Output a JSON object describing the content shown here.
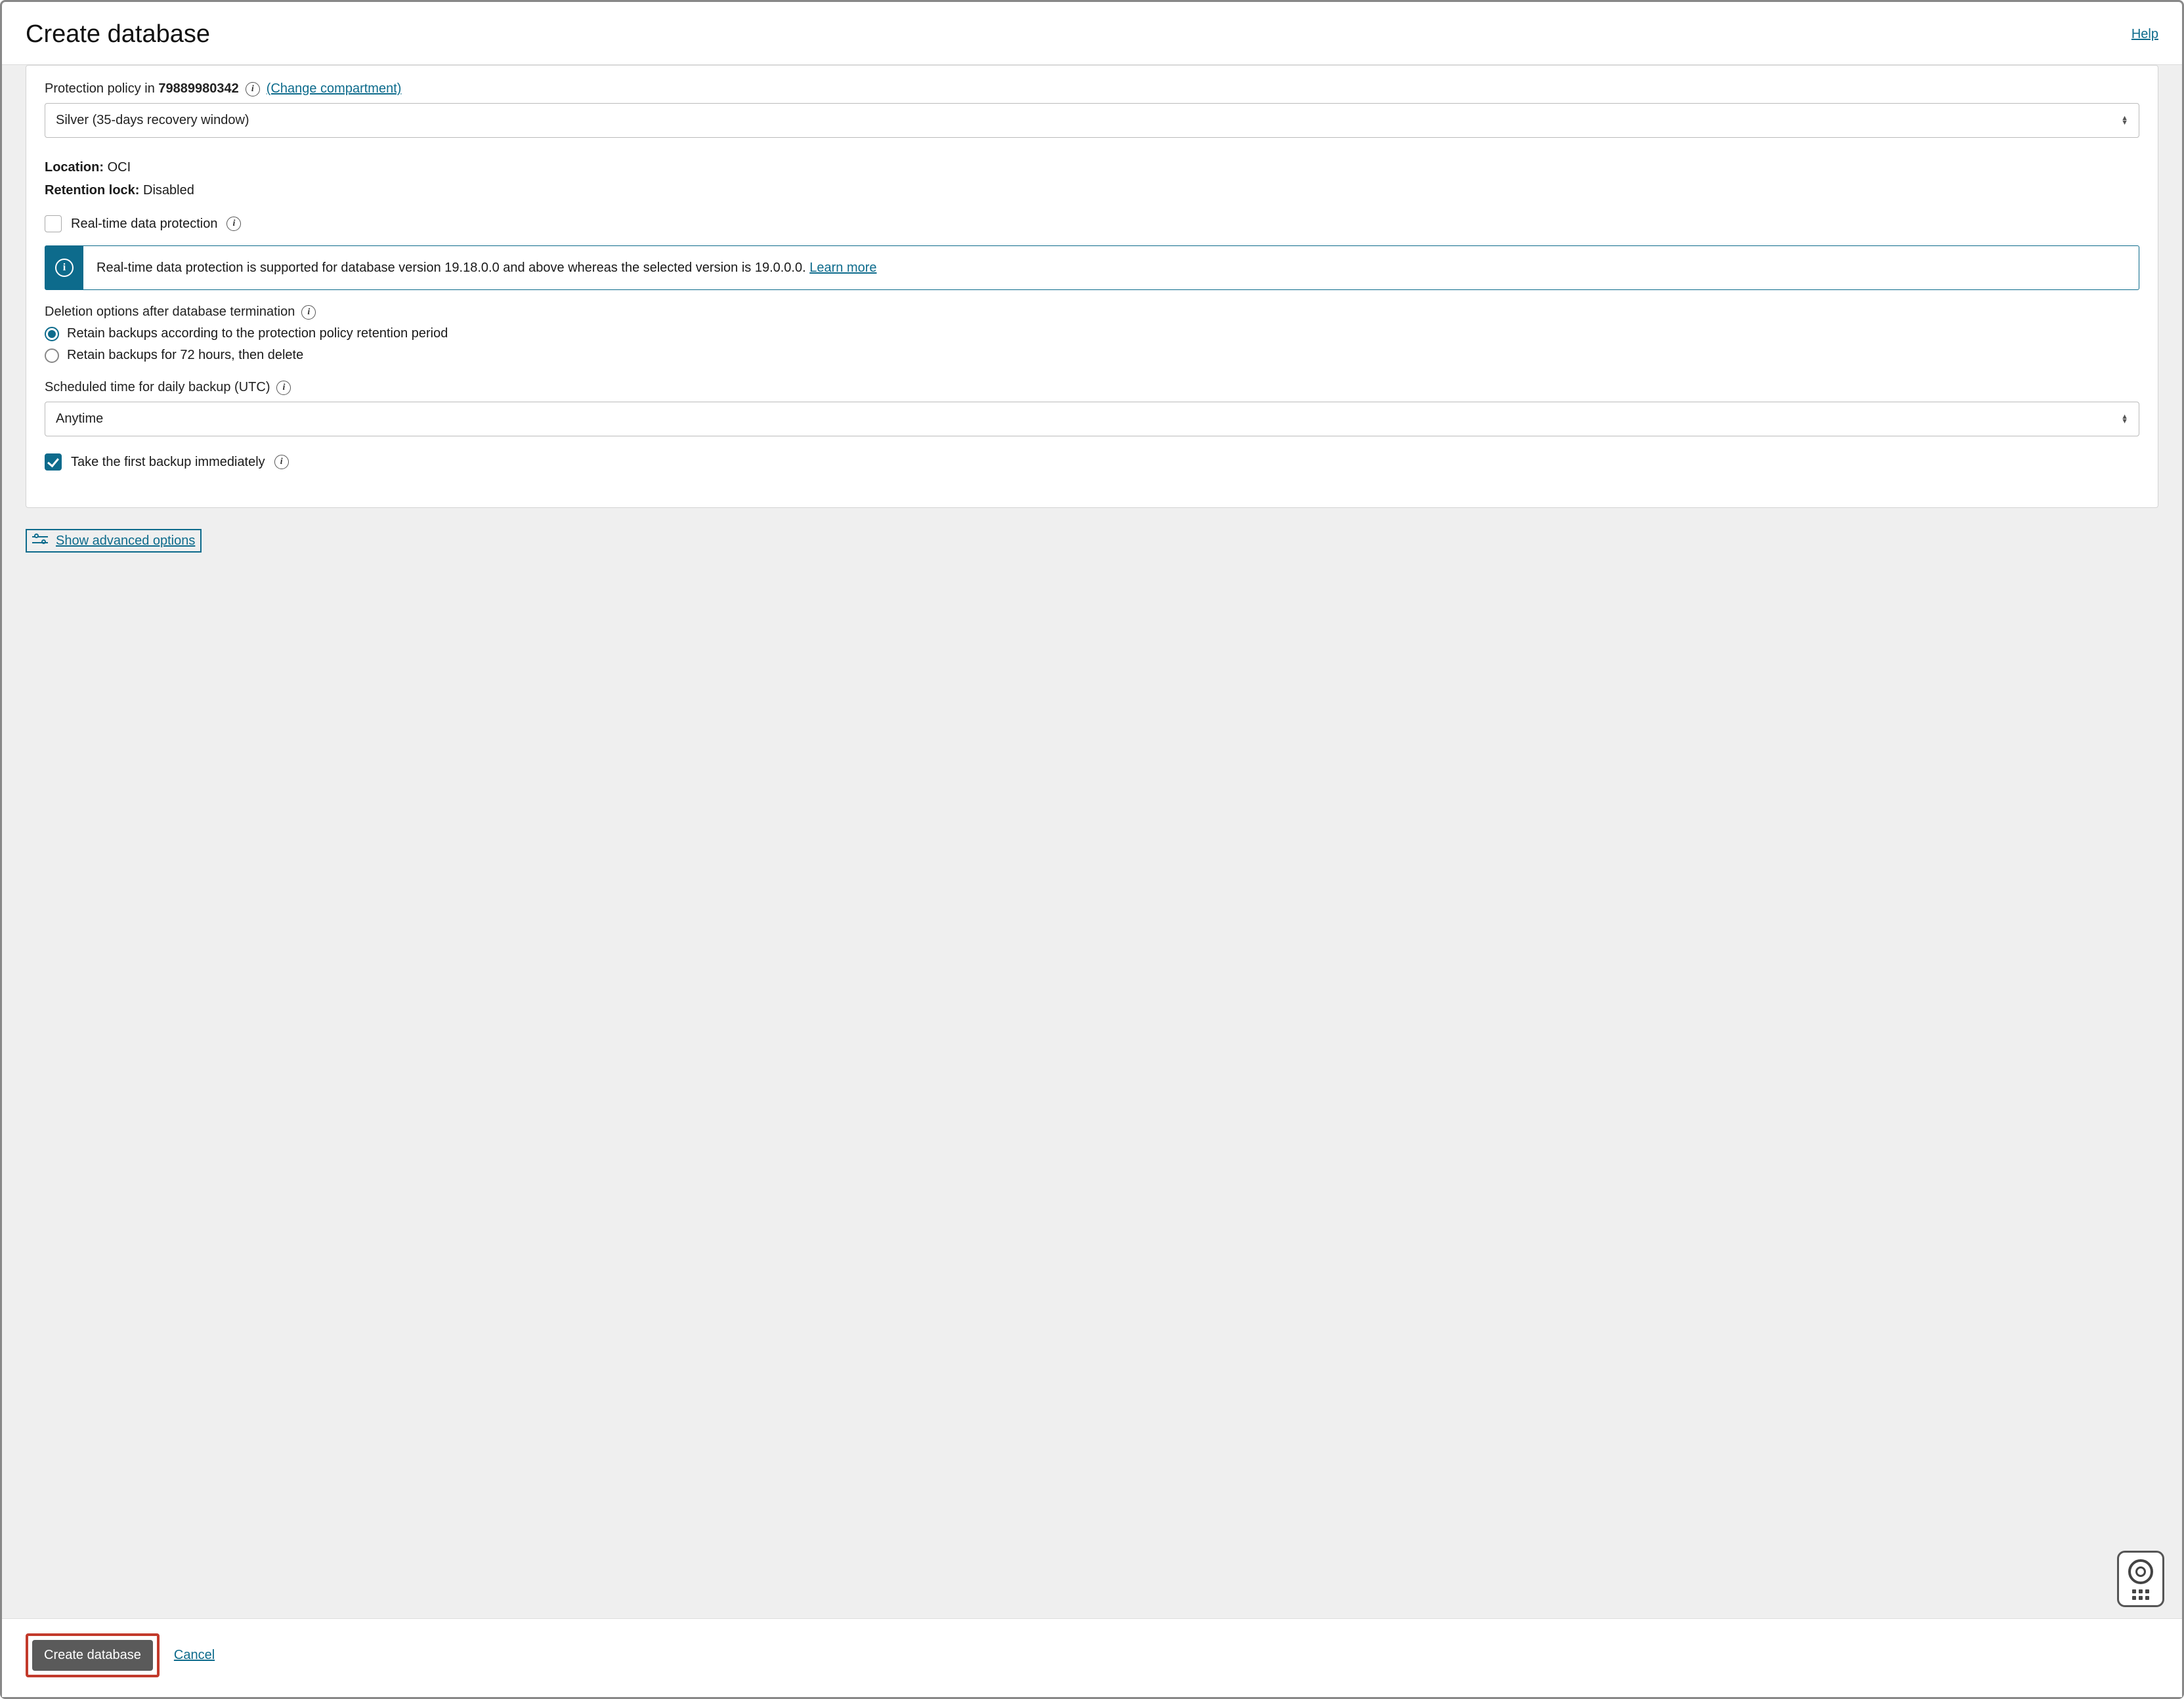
{
  "header": {
    "title": "Create database",
    "help": "Help"
  },
  "protection": {
    "label_prefix": "Protection policy in ",
    "compartment_id": "79889980342",
    "change_link": "(Change compartment)",
    "select_value": "Silver (35-days recovery window)"
  },
  "details": {
    "location_label": "Location:",
    "location_value": "OCI",
    "retention_lock_label": "Retention lock:",
    "retention_lock_value": "Disabled"
  },
  "realtime": {
    "label": "Real-time data protection",
    "banner_text": "Real-time data protection is supported for database version 19.18.0.0 and above whereas the selected version is 19.0.0.0. ",
    "learn_more": "Learn more"
  },
  "deletion": {
    "heading": "Deletion options after database termination",
    "opt1": "Retain backups according to the protection policy retention period",
    "opt2": "Retain backups for 72 hours, then delete"
  },
  "schedule": {
    "label": "Scheduled time for daily backup (UTC)",
    "value": "Anytime"
  },
  "first_backup": {
    "label": "Take the first backup immediately"
  },
  "advanced": {
    "label": "Show advanced options"
  },
  "footer": {
    "create": "Create database",
    "cancel": "Cancel"
  }
}
